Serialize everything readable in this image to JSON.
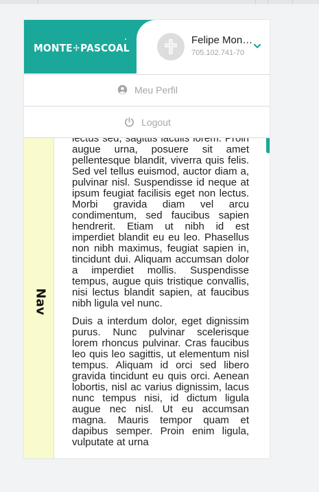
{
  "brand": {
    "name_left": "MONTE",
    "name_sep": "✢",
    "name_right": "PASCOAL"
  },
  "user": {
    "name": "Felipe Monteiro",
    "id": "705.102.741-70"
  },
  "menu": {
    "profile_label": "Meu Perfil",
    "logout_label": "Logout"
  },
  "nav": {
    "label": "Nav"
  },
  "content": {
    "paragraphs": [
      "lectus sed, sagittis iaculis lorem. Proin augue urna, posuere sit amet pellentesque blandit, viverra quis felis. Sed vel tellus euismod, auctor diam a, pulvinar nisl. Suspendisse id neque at ipsum feugiat facilisis eget non lectus. Morbi gravida diam vel arcu condimentum, sed faucibus sapien hendrerit. Etiam ut nibh id est imperdiet blandit eu eu leo. Phasellus non nibh maximus, feugiat sapien in, tincidunt dui. Aliquam accumsan dolor a imperdiet mollis. Suspendisse tempus, augue quis tristique convallis, nisi lectus blandit sapien, at faucibus nibh ligula vel nunc.",
      "Duis a interdum dolor, eget dignissim purus. Nunc pulvinar scelerisque lorem rhoncus pulvinar. Cras faucibus leo quis leo sagittis, ut elementum nisl tempus. Aliquam id orci sed libero gravida tincidunt eu quis orci. Aenean lobortis, nisl ac varius dignissim, lacus nunc tempus nisi, id dictum ligula augue nec nisl. Ut eu accumsan magna. Mauris tempor quam et dapibus semper. Proin enim ligula, vulputate at urna"
    ]
  },
  "colors": {
    "brand_teal": "#1aa89a",
    "nav_yellow": "#fafbcd",
    "menu_text": "#a3a7ab"
  }
}
